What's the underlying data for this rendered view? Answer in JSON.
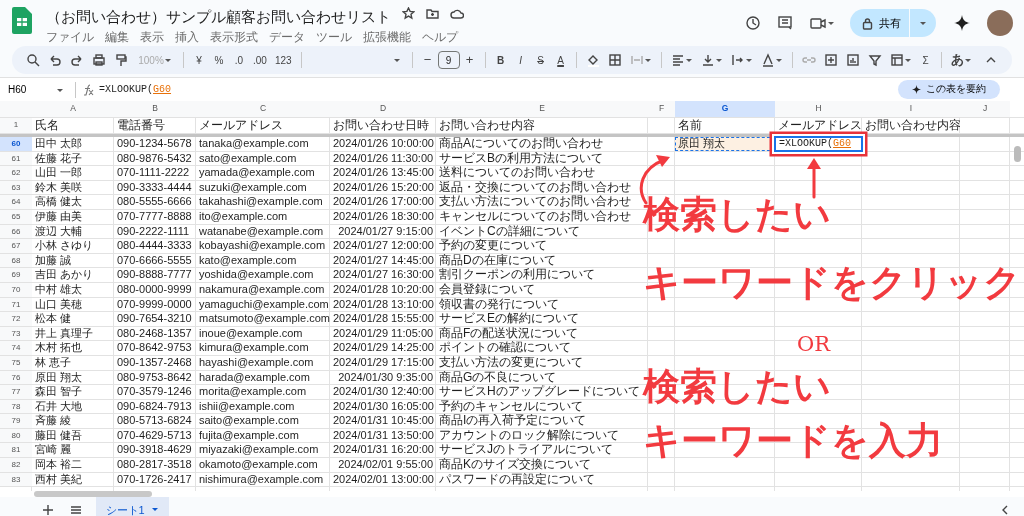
{
  "app": {
    "title": "（お問い合わせ）サンプル顧客お問い合わせリスト",
    "menu": [
      "ファイル",
      "編集",
      "表示",
      "挿入",
      "表示形式",
      "データ",
      "ツール",
      "拡張機能",
      "ヘルプ"
    ],
    "share_label": "共有"
  },
  "toolbar": {
    "zoom": {
      "text": "100%",
      "disabled": true
    },
    "currency": "¥",
    "percent": "%",
    "decrease_decimals": ".0",
    "increase_decimals": ".00",
    "number_format": "123",
    "minus": "−",
    "font_size": "9",
    "plus": "+",
    "bold": "B",
    "italic": "I",
    "strikethrough": "S",
    "text_color": "A",
    "functions": "Σ",
    "input_tools": "あ"
  },
  "formula_bar": {
    "cell_ref": "H60",
    "function_text": "=XLOOKUP(",
    "reference": "G60"
  },
  "summarize_button": "この表を要約",
  "sheet": {
    "columns": [
      {
        "label": "A",
        "selected": false
      },
      {
        "label": "B",
        "selected": false
      },
      {
        "label": "C",
        "selected": false
      },
      {
        "label": "D",
        "selected": false
      },
      {
        "label": "E",
        "selected": false
      },
      {
        "label": "F",
        "selected": false
      },
      {
        "label": "G",
        "selected": true
      },
      {
        "label": "H",
        "selected": false
      },
      {
        "label": "I",
        "selected": false
      },
      {
        "label": "J",
        "selected": false
      }
    ],
    "header_row": {
      "number": "1",
      "cells": [
        "氏名",
        "電話番号",
        "メールアドレス",
        "お問い合わせ日時",
        "お問い合わせ内容"
      ],
      "lookup_headers": [
        "名前",
        "メールアドレス",
        "お問い合わせ内容"
      ]
    },
    "rows": [
      {
        "number": "60",
        "selected": true,
        "cells": [
          "田中 太郎",
          "090-1234-5678",
          "tanaka@example.com",
          "2024/01/26 10:00:00",
          "商品Aについてのお問い合わせ"
        ],
        "lookup_key": "原田 翔太",
        "editing_formula": {
          "function_text": "=XLOOKUP(",
          "reference": "G60"
        }
      },
      {
        "number": "61",
        "selected": false,
        "cells": [
          "佐藤 花子",
          "080-9876-5432",
          "sato@example.com",
          "2024/01/26 11:30:00",
          "サービスBの利用方法について"
        ]
      },
      {
        "number": "62",
        "selected": false,
        "cells": [
          "山田 一郎",
          "070-1111-2222",
          "yamada@example.com",
          "2024/01/26 13:45:00",
          "送料についてのお問い合わせ"
        ]
      },
      {
        "number": "63",
        "selected": false,
        "cells": [
          "鈴木 美咲",
          "090-3333-4444",
          "suzuki@example.com",
          "2024/01/26 15:20:00",
          "返品・交換についてのお問い合わせ"
        ]
      },
      {
        "number": "64",
        "selected": false,
        "cells": [
          "高橋 健太",
          "080-5555-6666",
          "takahashi@example.com",
          "2024/01/26 17:00:00",
          "支払い方法についてのお問い合わせ"
        ]
      },
      {
        "number": "65",
        "selected": false,
        "cells": [
          "伊藤 由美",
          "070-7777-8888",
          "ito@example.com",
          "2024/01/26 18:30:00",
          "キャンセルについてのお問い合わせ"
        ]
      },
      {
        "number": "66",
        "selected": false,
        "cells": [
          "渡辺 大輔",
          "090-2222-1111",
          "watanabe@example.com",
          "2024/01/27 9:15:00",
          "イベントCの詳細について"
        ]
      },
      {
        "number": "67",
        "selected": false,
        "cells": [
          "小林 さゆり",
          "080-4444-3333",
          "kobayashi@example.com",
          "2024/01/27 12:00:00",
          "予約の変更について"
        ]
      },
      {
        "number": "68",
        "selected": false,
        "cells": [
          "加藤 誠",
          "070-6666-5555",
          "kato@example.com",
          "2024/01/27 14:45:00",
          "商品Dの在庫について"
        ]
      },
      {
        "number": "69",
        "selected": false,
        "cells": [
          "吉田 あかり",
          "090-8888-7777",
          "yoshida@example.com",
          "2024/01/27 16:30:00",
          "割引クーポンの利用について"
        ]
      },
      {
        "number": "70",
        "selected": false,
        "cells": [
          "中村 雄太",
          "080-0000-9999",
          "nakamura@example.com",
          "2024/01/28 10:20:00",
          "会員登録について"
        ]
      },
      {
        "number": "71",
        "selected": false,
        "cells": [
          "山口 美穂",
          "070-9999-0000",
          "yamaguchi@example.com",
          "2024/01/28 13:10:00",
          "領収書の発行について"
        ]
      },
      {
        "number": "72",
        "selected": false,
        "cells": [
          "松本 健",
          "090-7654-3210",
          "matsumoto@example.com",
          "2024/01/28 15:55:00",
          "サービスEの解約について"
        ]
      },
      {
        "number": "73",
        "selected": false,
        "cells": [
          "井上 真理子",
          "080-2468-1357",
          "inoue@example.com",
          "2024/01/29 11:05:00",
          "商品Fの配送状況について"
        ]
      },
      {
        "number": "74",
        "selected": false,
        "cells": [
          "木村 拓也",
          "070-8642-9753",
          "kimura@example.com",
          "2024/01/29 14:25:00",
          "ポイントの確認について"
        ]
      },
      {
        "number": "75",
        "selected": false,
        "cells": [
          "林 恵子",
          "090-1357-2468",
          "hayashi@example.com",
          "2024/01/29 17:15:00",
          "支払い方法の変更について"
        ]
      },
      {
        "number": "76",
        "selected": false,
        "cells": [
          "原田 翔太",
          "080-9753-8642",
          "harada@example.com",
          "2024/01/30 9:35:00",
          "商品Gの不良について"
        ]
      },
      {
        "number": "77",
        "selected": false,
        "cells": [
          "森田 智子",
          "070-3579-1246",
          "morita@example.com",
          "2024/01/30 12:40:00",
          "サービスHのアップグレードについて"
        ]
      },
      {
        "number": "78",
        "selected": false,
        "cells": [
          "石井 大地",
          "090-6824-7913",
          "ishii@example.com",
          "2024/01/30 16:05:00",
          "予約のキャンセルについて"
        ]
      },
      {
        "number": "79",
        "selected": false,
        "cells": [
          "斉藤 綾",
          "080-5713-6824",
          "saito@example.com",
          "2024/01/31 10:45:00",
          "商品Iの再入荷予定について"
        ]
      },
      {
        "number": "80",
        "selected": false,
        "cells": [
          "藤田 健吾",
          "070-4629-5713",
          "fujita@example.com",
          "2024/01/31 13:50:00",
          "アカウントのロック解除について"
        ]
      },
      {
        "number": "81",
        "selected": false,
        "cells": [
          "宮崎 麗",
          "090-3918-4629",
          "miyazaki@example.com",
          "2024/01/31 16:20:00",
          "サービスJのトライアルについて"
        ]
      },
      {
        "number": "82",
        "selected": false,
        "cells": [
          "岡本 裕二",
          "080-2817-3518",
          "okamoto@example.com",
          "2024/02/01 9:55:00",
          "商品Kのサイズ交換について"
        ]
      },
      {
        "number": "83",
        "selected": false,
        "cells": [
          "西村 美紀",
          "070-1726-2417",
          "nishimura@example.com",
          "2024/02/01 13:00:00",
          "パスワードの再設定について"
        ]
      }
    ]
  },
  "annotations": [
    {
      "kind": "callout",
      "text": "検索したい"
    },
    {
      "kind": "callout",
      "text": "キーワードをクリック"
    },
    {
      "kind": "connector",
      "text": "OR"
    },
    {
      "kind": "callout",
      "text": "検索したい"
    },
    {
      "kind": "callout",
      "text": "キーワードを入力"
    }
  ],
  "sheet_tabs": [
    {
      "label": "シート1",
      "selected": true
    }
  ]
}
